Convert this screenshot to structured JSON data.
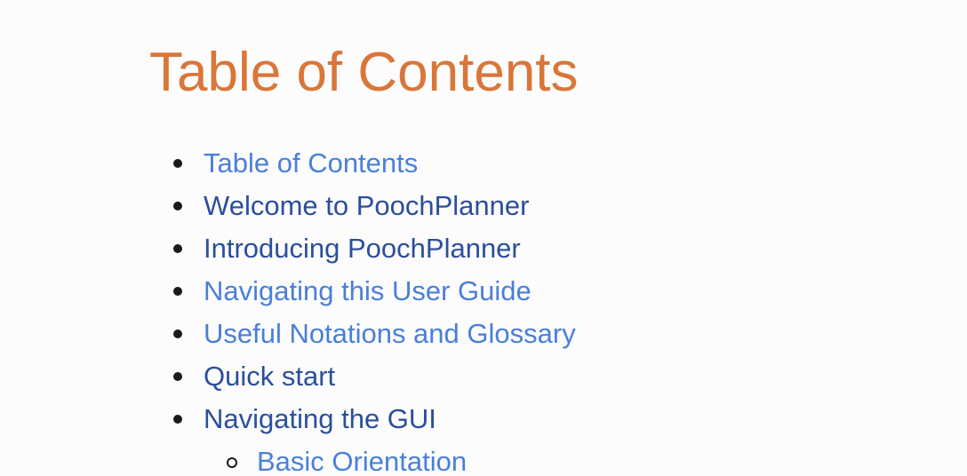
{
  "page": {
    "title": "Table of Contents"
  },
  "toc": {
    "items": [
      {
        "label": "Table of Contents",
        "state": "unvisited"
      },
      {
        "label": "Welcome to PoochPlanner",
        "state": "visited"
      },
      {
        "label": "Introducing PoochPlanner",
        "state": "visited"
      },
      {
        "label": "Navigating this User Guide",
        "state": "unvisited"
      },
      {
        "label": "Useful Notations and Glossary",
        "state": "unvisited"
      },
      {
        "label": "Quick start",
        "state": "visited"
      },
      {
        "label": "Navigating the GUI",
        "state": "visited"
      }
    ],
    "sub_items": [
      {
        "label": "Basic Orientation",
        "state": "unvisited"
      }
    ]
  },
  "colors": {
    "title": "#d97638",
    "link_unvisited": "#4a7fd9",
    "link_visited": "#2c4f9b",
    "bullet": "#1a1a1a",
    "background": "#fcfcfd"
  }
}
